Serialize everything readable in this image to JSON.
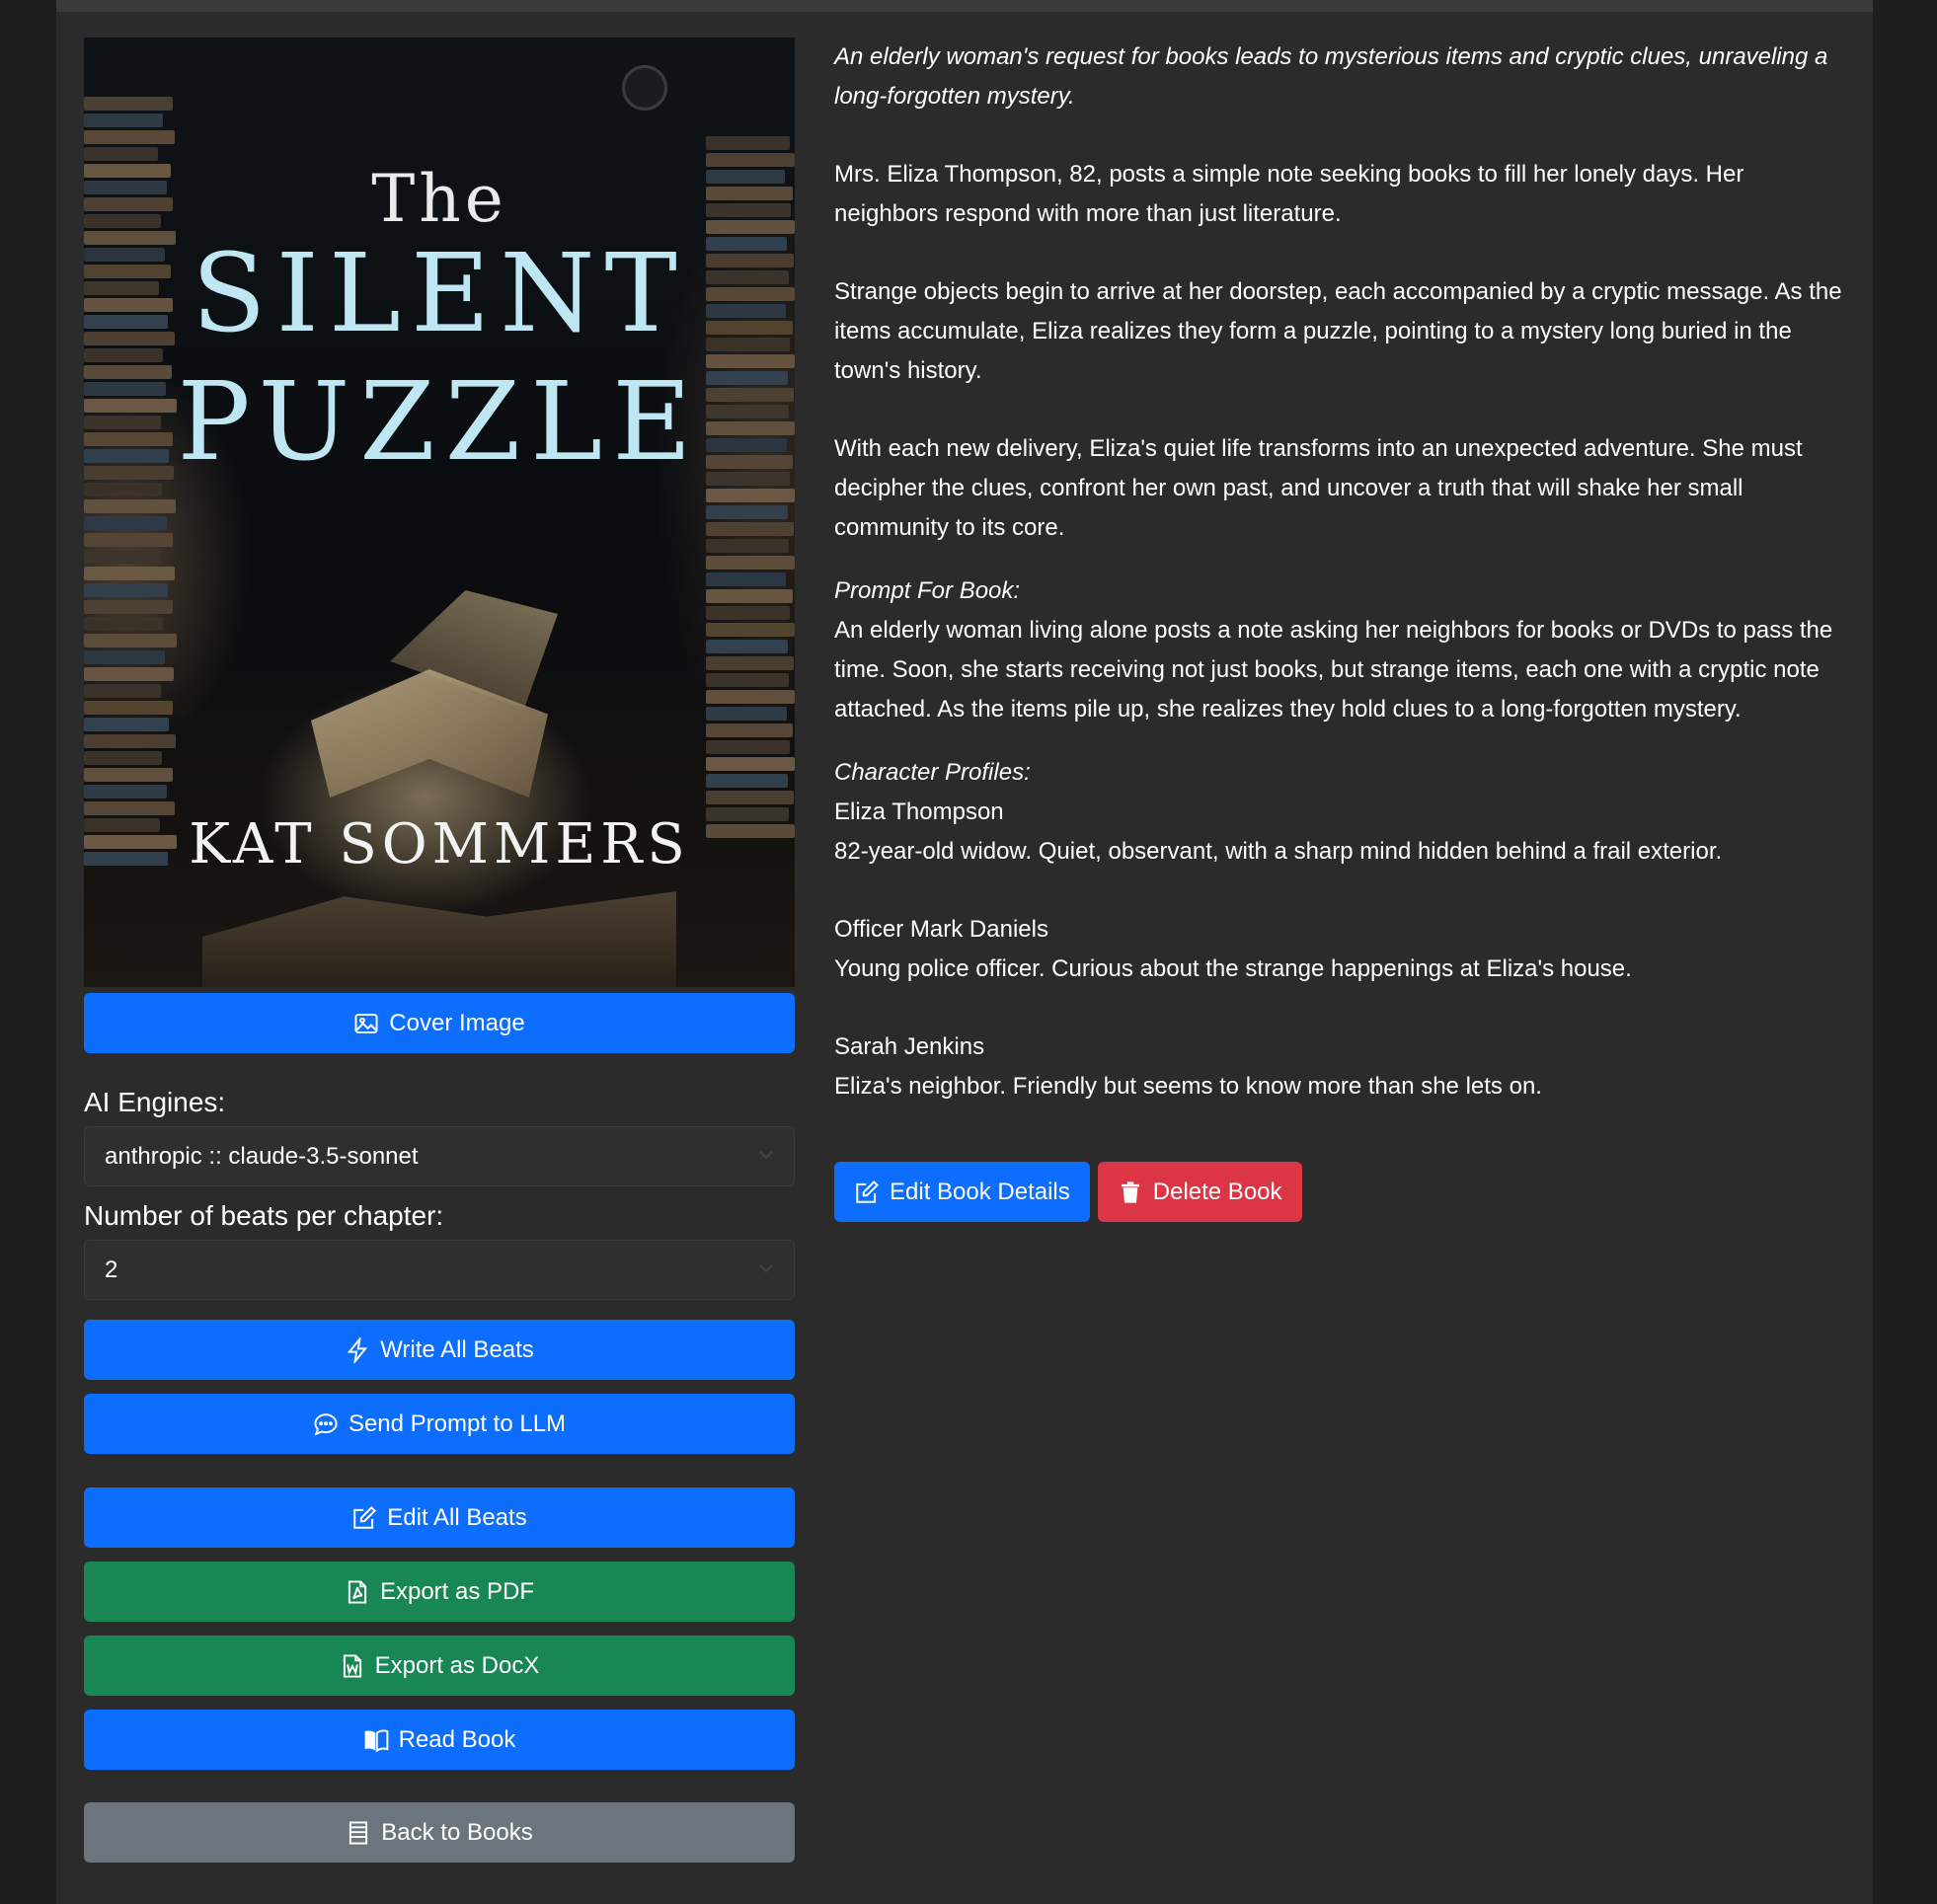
{
  "cover": {
    "title_the": "The",
    "title_line1": "SILENT",
    "title_line2": "PUZZLE",
    "author": "KAT SOMMERS"
  },
  "buttons": {
    "cover_image": "Cover Image",
    "write_all_beats": "Write All Beats",
    "send_prompt": "Send Prompt to LLM",
    "edit_all_beats": "Edit All Beats",
    "export_pdf": "Export as PDF",
    "export_docx": "Export as DocX",
    "read_book": "Read Book",
    "back_to_books": "Back to Books",
    "edit_book_details": "Edit Book Details",
    "delete_book": "Delete Book"
  },
  "ai_engines": {
    "label": "AI Engines:",
    "selected": "anthropic :: claude-3.5-sonnet"
  },
  "beats": {
    "label": "Number of beats per chapter:",
    "selected": "2"
  },
  "details": {
    "tagline": "An elderly woman's request for books leads to mysterious items and cryptic clues, unraveling a long-forgotten mystery.",
    "blurb": [
      "Mrs. Eliza Thompson, 82, posts a simple note seeking books to fill her lonely days. Her neighbors respond with more than just literature.",
      "Strange objects begin to arrive at her doorstep, each accompanied by a cryptic message. As the items accumulate, Eliza realizes they form a puzzle, pointing to a mystery long buried in the town's history.",
      "With each new delivery, Eliza's quiet life transforms into an unexpected adventure. She must decipher the clues, confront her own past, and uncover a truth that will shake her small community to its core."
    ],
    "prompt_heading": "Prompt For Book:",
    "prompt": "An elderly woman living alone posts a note asking her neighbors for books or DVDs to pass the time. Soon, she starts receiving not just books, but strange items, each one with a cryptic note attached. As the items pile up, she realizes they hold clues to a long-forgotten mystery.",
    "characters_heading": "Character Profiles:",
    "characters": [
      {
        "name": "Eliza Thompson",
        "desc": "82-year-old widow. Quiet, observant, with a sharp mind hidden behind a frail exterior."
      },
      {
        "name": "Officer Mark Daniels",
        "desc": "Young police officer. Curious about the strange happenings at Eliza's house."
      },
      {
        "name": "Sarah Jenkins",
        "desc": "Eliza's neighbor. Friendly but seems to know more than she lets on."
      }
    ]
  },
  "colors": {
    "primary": "#0d6efd",
    "success": "#198754",
    "secondary": "#6c757d",
    "danger": "#dc3545",
    "background": "#2b2b2b"
  }
}
